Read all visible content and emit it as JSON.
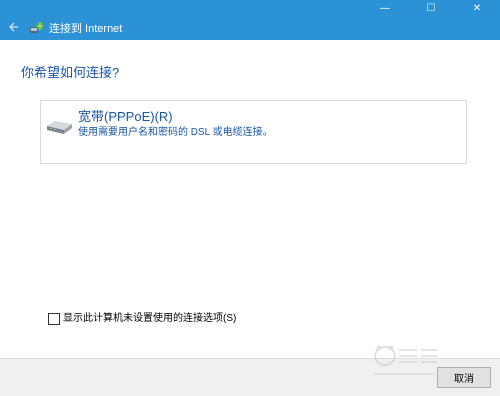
{
  "window": {
    "title": "连接到 Internet",
    "controls": {
      "minimize": "—",
      "maximize": "☐",
      "close": "✕"
    },
    "title_bar_color": "#2b93d5"
  },
  "question": "你希望如何连接?",
  "options": [
    {
      "title": "宽带(PPPoE)(R)",
      "description": "使用需要用户名和密码的 DSL 或电缆连接。",
      "icon": "modem-icon"
    }
  ],
  "checkbox": {
    "label": "显示此计算机未设置使用的连接选项(S)",
    "checked": false
  },
  "footer": {
    "cancel_label": "取消"
  },
  "accent_text_color": "#1a56a6"
}
